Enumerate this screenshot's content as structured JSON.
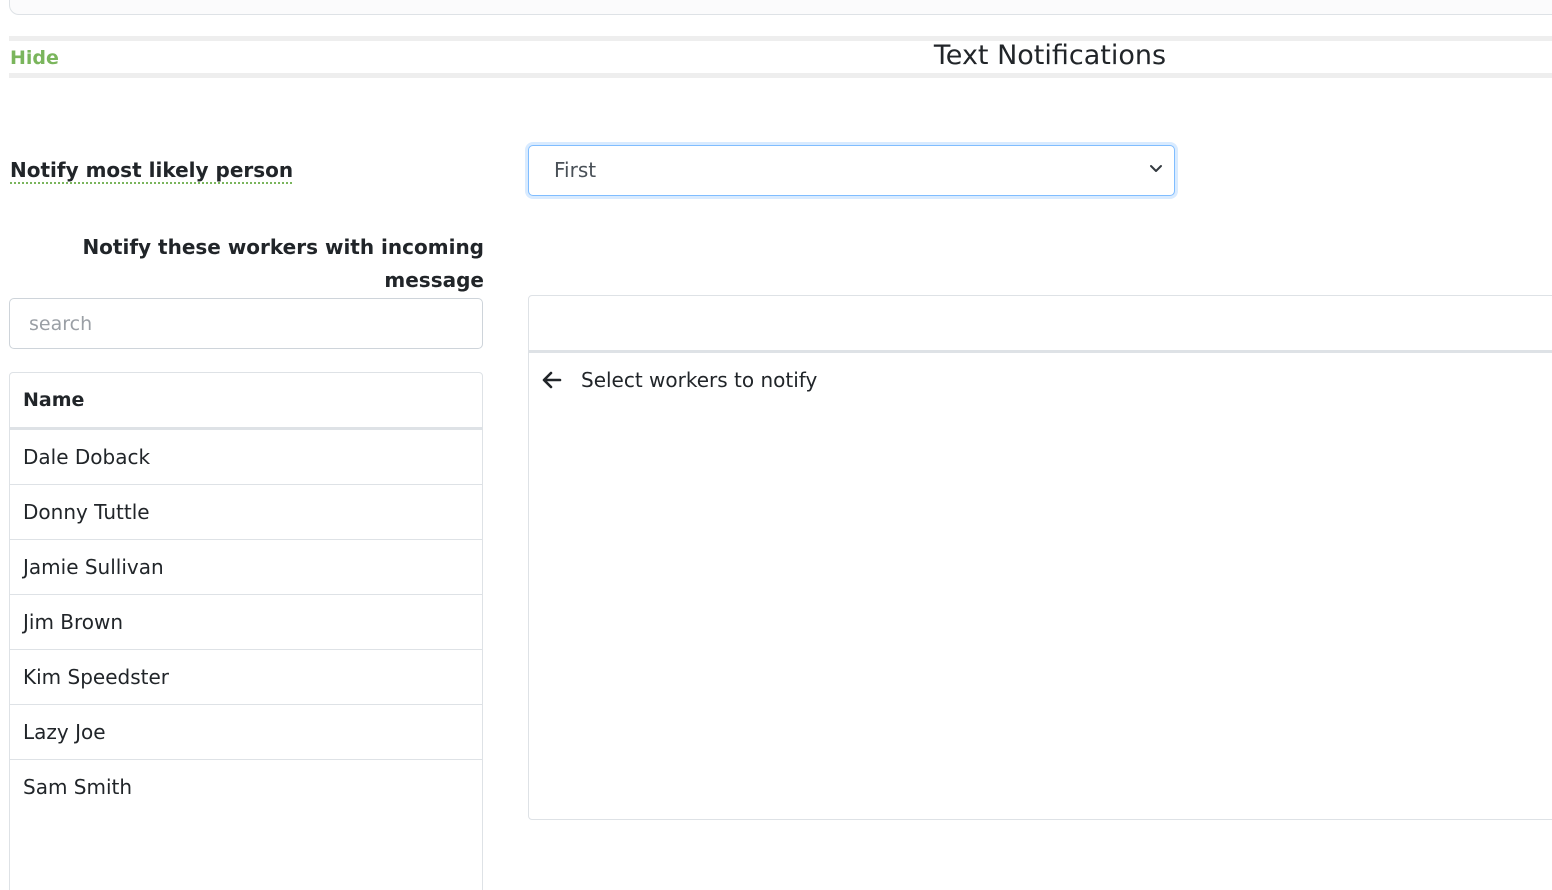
{
  "header": {
    "hide_label": "Hide",
    "title": "Text Notifications"
  },
  "notify_most_likely": {
    "label": "Notify most likely person",
    "selected": "First"
  },
  "workers": {
    "label": "Notify these workers with incoming message",
    "search_placeholder": "search",
    "column_header": "Name",
    "names": [
      "Dale Doback",
      "Donny Tuttle",
      "Jamie Sullivan",
      "Jim Brown",
      "Kim Speedster",
      "Lazy Joe",
      "Sam Smith"
    ]
  },
  "selected_panel": {
    "hint": "Select workers to notify",
    "hint_icon": "arrow-left-icon"
  },
  "colors": {
    "accent_green": "#7ab55c",
    "focus_border": "#80bdff"
  }
}
